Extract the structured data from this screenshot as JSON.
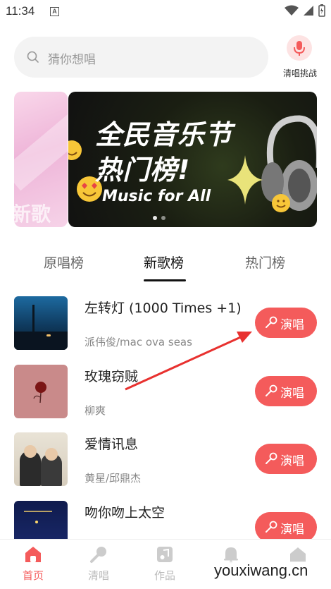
{
  "status_bar": {
    "time": "11:34",
    "badge": "A"
  },
  "search": {
    "placeholder": "猜你想唱",
    "clear_sing_label": "清唱挑战"
  },
  "banner": {
    "title_line1": "全民音乐节",
    "title_line2": "热门榜!",
    "subtitle": "Music for All",
    "side_text": "新歌"
  },
  "tabs": [
    {
      "label": "原唱榜",
      "active": false
    },
    {
      "label": "新歌榜",
      "active": true
    },
    {
      "label": "热门榜",
      "active": false
    }
  ],
  "songs": [
    {
      "title": "左转灯 (1000 Times +1)",
      "artist": "派伟俊/mac ova seas",
      "button": "演唱"
    },
    {
      "title": "玫瑰窃贼",
      "artist": "柳爽",
      "button": "演唱"
    },
    {
      "title": "爱情讯息",
      "artist": "黄星/邱鼎杰",
      "button": "演唱"
    },
    {
      "title": "吻你吻上太空",
      "artist": "",
      "button": "演唱"
    }
  ],
  "bottom_nav": [
    {
      "label": "首页",
      "icon": "home-icon",
      "active": true
    },
    {
      "label": "清唱",
      "icon": "mic-icon",
      "active": false
    },
    {
      "label": "作品",
      "icon": "music-note-icon",
      "active": false
    },
    {
      "label": "",
      "icon": "bell-icon",
      "active": false
    },
    {
      "label": "",
      "icon": "profile-icon",
      "active": false
    }
  ],
  "watermark": "youxiwang.cn",
  "colors": {
    "accent": "#f45b5b",
    "accent_light": "#fde3e3"
  }
}
